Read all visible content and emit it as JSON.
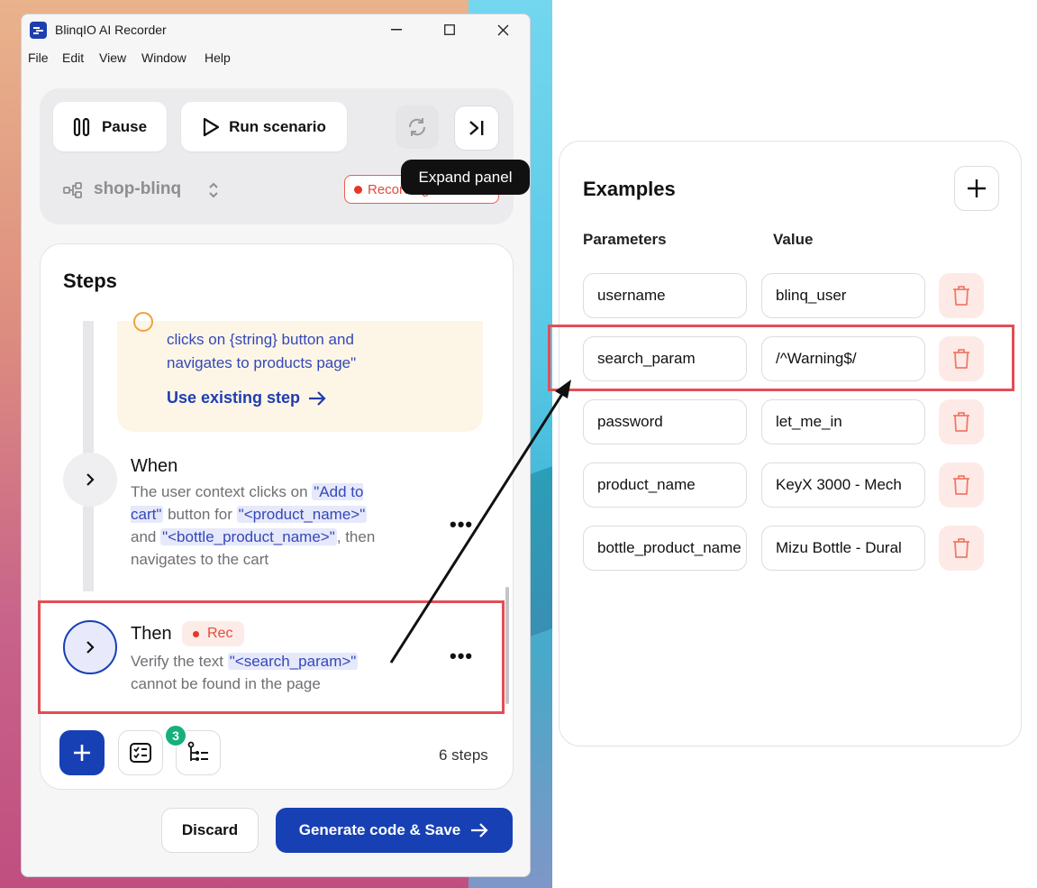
{
  "window": {
    "title": "BlinqIO AI Recorder",
    "menu": [
      "File",
      "Edit",
      "View",
      "Window",
      "Help"
    ]
  },
  "toolbar": {
    "pause_label": "Pause",
    "run_label": "Run scenario",
    "project": "shop-blinq",
    "recording_label": "Recording",
    "tooltip": "Expand panel"
  },
  "steps": {
    "title": "Steps",
    "suggestion": {
      "text": "clicks on {string} button and navigates to products page\"",
      "action": "Use existing step"
    },
    "items": [
      {
        "keyword": "When",
        "parts": [
          {
            "t": "The user context clicks on ",
            "chip": false
          },
          {
            "t": "\"Add to cart\"",
            "chip": true
          },
          {
            "t": " button for ",
            "chip": false
          },
          {
            "t": "\"<product_name>\"",
            "chip": true
          },
          {
            "t": " and ",
            "chip": false
          },
          {
            "t": "\"<bottle_product_name>\"",
            "chip": true
          },
          {
            "t": ", then navigates to the cart",
            "chip": false
          }
        ]
      },
      {
        "keyword": "Then",
        "badge": "Rec",
        "parts": [
          {
            "t": "Verify the text ",
            "chip": false
          },
          {
            "t": "\"<search_param>\"",
            "chip": true
          },
          {
            "t": " cannot be found in the page",
            "chip": false
          }
        ]
      }
    ],
    "badge_count": "3",
    "count_label": "6 steps"
  },
  "footer": {
    "discard_label": "Discard",
    "generate_label": "Generate code & Save"
  },
  "examples": {
    "title": "Examples",
    "col_param": "Parameters",
    "col_value": "Value",
    "rows": [
      {
        "param": "username",
        "value": "blinq_user"
      },
      {
        "param": "search_param",
        "value": "/^Warning$/"
      },
      {
        "param": "password",
        "value": "let_me_in"
      },
      {
        "param": "product_name",
        "value": "KeyX 3000 - Mech"
      },
      {
        "param": "bottle_product_name",
        "value": "Mizu Bottle - Dural"
      }
    ]
  },
  "colors": {
    "primary": "#1740b4",
    "rec_red": "#e24b3c",
    "highlight": "#e24e55",
    "badge_green": "#16b07c"
  }
}
